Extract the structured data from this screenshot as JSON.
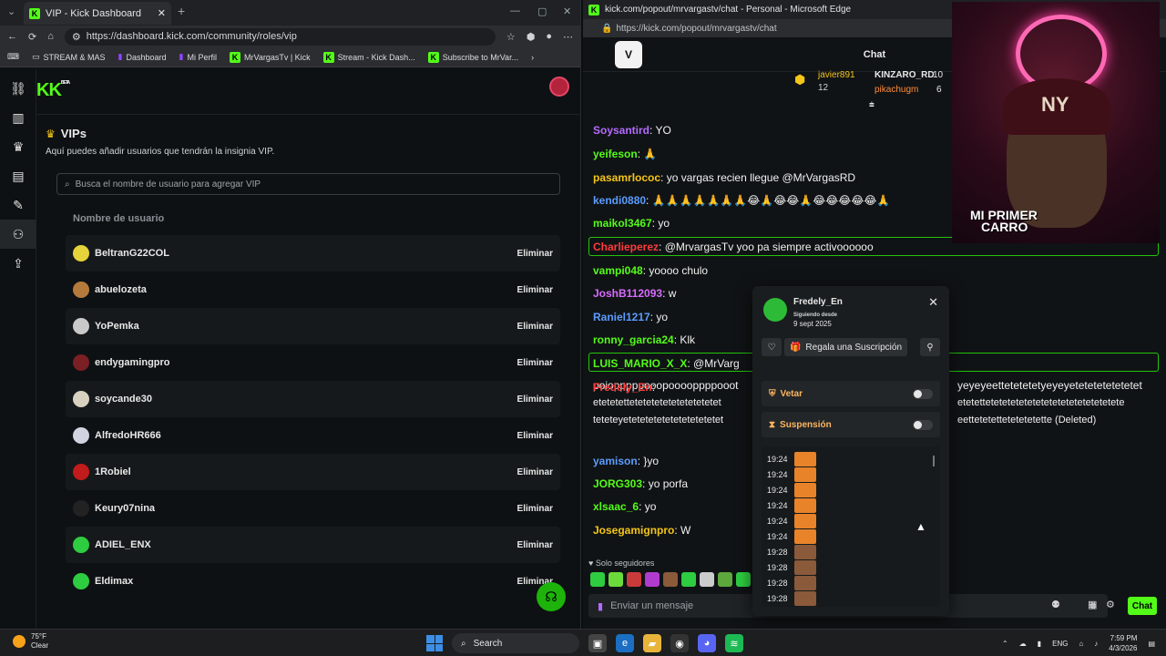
{
  "left_window": {
    "tab_title": "VIP - Kick Dashboard",
    "url": "https://dashboard.kick.com/community/roles/vip",
    "bookmarks": [
      "STREAM & MAS",
      "Dashboard",
      "Mi Perfil",
      "MrVargasTv | Kick",
      "Stream - Kick Dash...",
      "Subscribe to MrVar..."
    ],
    "logo": "K",
    "logo_badge": "BETA",
    "section_title": "VIPs",
    "section_desc": "Aquí puedes añadir usuarios que tendrán la insignia VIP.",
    "search_placeholder": "Busca el nombre de usuario para agregar VIP",
    "column_header": "Nombre de usuario",
    "remove_label": "Eliminar",
    "users": [
      "BeltranG22COL",
      "abuelozeta",
      "YoPemka",
      "endygamingpro",
      "soycande30",
      "AlfredoHR666",
      "1Robiel",
      "Keury07nina",
      "ADIEL_ENX",
      "Eldimax"
    ],
    "avatar_colors": [
      "#e6d23a",
      "#b47a3c",
      "#c9c9c9",
      "#7a1f24",
      "#d9d1c0",
      "#d0d4e0",
      "#c21b1b",
      "#222",
      "#2ecc40",
      "#2ecc40"
    ]
  },
  "right_window": {
    "title": "kick.com/popout/mrvargastv/chat - Personal - Microsoft Edge",
    "url": "https://kick.com/popout/mrvargastv/chat",
    "chat_header": "Chat",
    "leaderboard": [
      {
        "user": "javier891",
        "value": "12"
      },
      {
        "user": "KINZARO_RD",
        "value": "10"
      },
      {
        "user": "pikachugm",
        "value": "6"
      }
    ],
    "messages": [
      {
        "user": "Soysantird",
        "color": "#b36bff",
        "text": ": YO"
      },
      {
        "user": "yeifeson",
        "color": "#53fc18",
        "text": ": 🙏"
      },
      {
        "user": "pasamrlococ",
        "color": "#f5c518",
        "text": ": yo vargas recien llegue @MrVargasRD"
      },
      {
        "user": "kendi0880",
        "color": "#5b9cff",
        "text": ": 🙏🙏🙏🙏🙏🙏🙏😂🙏😂😂🙏😂😂😂😂😂🙏"
      },
      {
        "user": "maikol3467",
        "color": "#53fc18",
        "text": ": yo"
      },
      {
        "user": "Charlieperez",
        "color": "#ff3b3b",
        "text": ": @MrvargasTv yoo pa siempre activoooooo"
      },
      {
        "user": "vampi048",
        "color": "#53fc18",
        "text": ": yoooo chulo"
      },
      {
        "user": "JoshB112093",
        "color": "#d86bff",
        "text": ": w"
      },
      {
        "user": "Raniel1217",
        "color": "#5b9cff",
        "text": ": yo"
      },
      {
        "user": "ronny_garcia24",
        "color": "#53fc18",
        "text": ": Klk"
      },
      {
        "user": "LUIS_MARIO_X_X",
        "color": "#53fc18",
        "text": ": @MrVarg"
      },
      {
        "user": "Fredely_En",
        "color": "#ff3b3b",
        "text": ":"
      },
      {
        "user": "yamison",
        "color": "#5b9cff",
        "text": ": }yo"
      },
      {
        "user": "JORG303",
        "color": "#53fc18",
        "text": ": yo porfa"
      },
      {
        "user": "xlsaac_6",
        "color": "#53fc18",
        "text": ": yo"
      },
      {
        "user": "Josegamignpro",
        "color": "#f5c518",
        "text": ": W"
      }
    ],
    "fredely_line1": "poiopppppooopooooppppooot",
    "fredely_line1b": "yeyeyeettetetetetyeyeyetetetetetetetet",
    "fredely_line2": "etetetettetetetetetetetetetetet",
    "fredely_line2b": "etetettetetetetetetetetetetetetetetetete",
    "fredely_line3": "teteteyetetetetetetetetetetetet",
    "fredely_line3b": "eettetetettetetetetette (Deleted)",
    "solo_seguidores": "Solo seguidores",
    "input_placeholder": "Enviar un mensaje",
    "send_label": "Chat",
    "cam_label1": "MI PRIMER",
    "cam_label2": "CARRO"
  },
  "popup": {
    "username": "Fredely_En",
    "following_label": "Siguiendo desde",
    "following_date": "9 sept 2025",
    "gift_label": "Regala una Suscripción",
    "vetar_label": "Vetar",
    "suspension_label": "Suspensión",
    "log_times": [
      "19:24",
      "19:24",
      "19:24",
      "19:24",
      "19:24",
      "19:24",
      "19:28",
      "19:28",
      "19:28",
      "19:28"
    ]
  },
  "taskbar": {
    "temperature": "75°F",
    "weather": "Clear",
    "search": "Search",
    "lang": "ENG",
    "time": "7:59 PM",
    "date": "4/3/2026"
  }
}
